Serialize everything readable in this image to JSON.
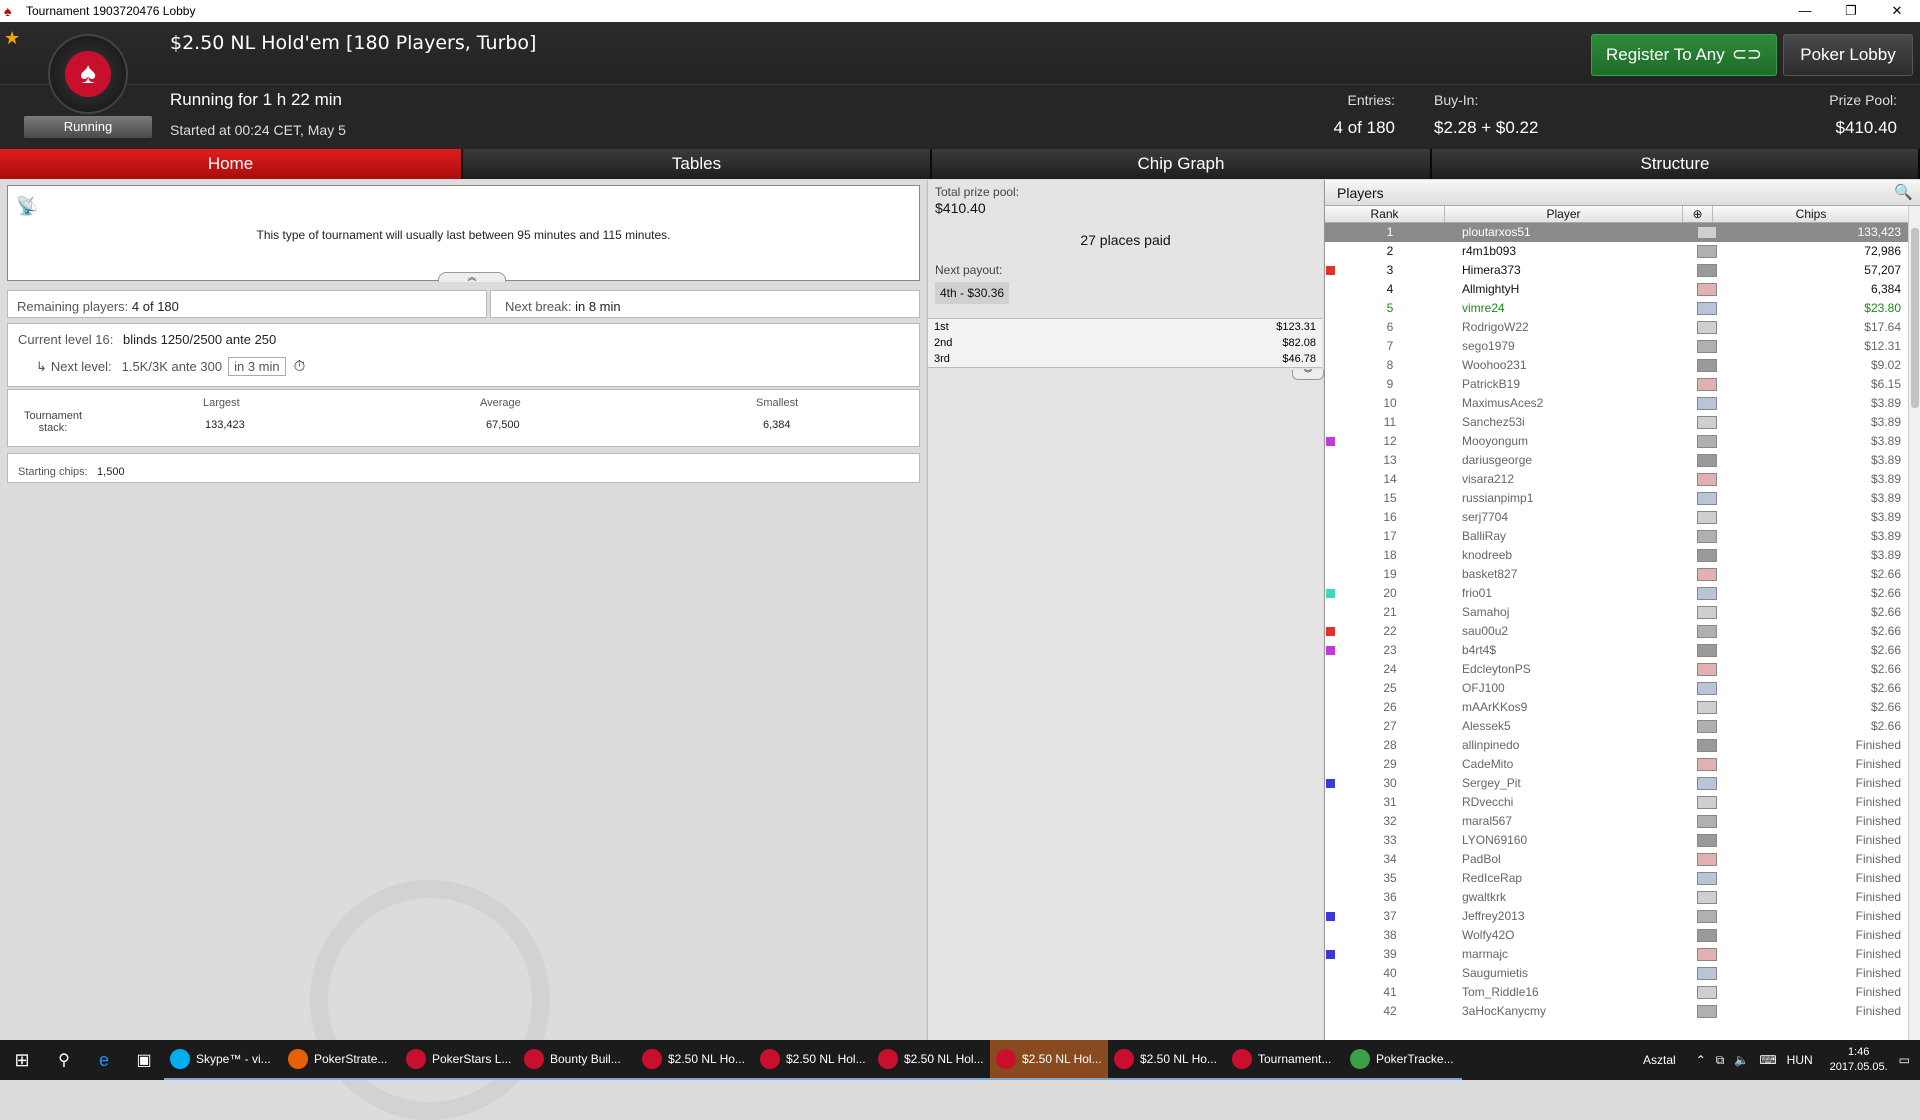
{
  "window": {
    "title": "Tournament 1903720476 Lobby",
    "minimize": "—",
    "restore": "❐",
    "close": "✕"
  },
  "header": {
    "title": "$2.50 NL Hold'em [180 Players, Turbo]",
    "running_for": "Running for 1 h 22 min",
    "started_at": "Started at 00:24 CET, May 5",
    "status_badge": "Running",
    "register_button": "Register To Any",
    "lobby_button": "Poker Lobby",
    "entries_label": "Entries:",
    "entries_value": "4 of 180",
    "buyin_label": "Buy-In:",
    "buyin_value": "$2.28 + $0.22",
    "prizepool_label": "Prize Pool:",
    "prizepool_value": "$410.40"
  },
  "tabs": [
    {
      "label": "Home",
      "active": true
    },
    {
      "label": "Tables",
      "active": false
    },
    {
      "label": "Chip Graph",
      "active": false
    },
    {
      "label": "Structure",
      "active": false
    }
  ],
  "home": {
    "info_text": "This type of tournament will usually last between 95 minutes and 115 minutes.",
    "remaining_label": "Remaining players:",
    "remaining_value": "4 of 180",
    "break_label": "Next break:",
    "break_value": "in 8 min",
    "current_level_label": "Current level 16:",
    "current_level_value": "blinds 1250/2500 ante 250",
    "next_level_label": "Next level:",
    "next_level_value": "1.5K/3K ante 300",
    "next_level_time": "in 3 min",
    "stack_label": "Tournament stack:",
    "largest_label": "Largest",
    "largest_value": "133,423",
    "average_label": "Average",
    "average_value": "67,500",
    "smallest_label": "Smallest",
    "smallest_value": "6,384",
    "starting_chips_label": "Starting chips:",
    "starting_chips_value": "1,500"
  },
  "prizes": {
    "total_label": "Total prize pool:",
    "total_value": "$410.40",
    "places_paid": "27 places paid",
    "next_payout_label": "Next payout:",
    "next_payout_value": "4th - $30.36",
    "payouts": [
      {
        "place": "1st",
        "amount": "$123.31"
      },
      {
        "place": "2nd",
        "amount": "$82.08"
      },
      {
        "place": "3rd",
        "amount": "$46.78"
      }
    ]
  },
  "players": {
    "title": "Players",
    "col_rank": "Rank",
    "col_player": "Player",
    "col_chips": "Chips",
    "rows": [
      {
        "rank": "1",
        "name": "ploutarxos51",
        "chips": "133,423",
        "style": "sel",
        "marker": ""
      },
      {
        "rank": "2",
        "name": "r4m1b093",
        "chips": "72,986",
        "style": "",
        "marker": ""
      },
      {
        "rank": "3",
        "name": "Himera373",
        "chips": "57,207",
        "style": "",
        "marker": "#e0312a"
      },
      {
        "rank": "4",
        "name": "AllmightyH",
        "chips": "6,384",
        "style": "",
        "marker": ""
      },
      {
        "rank": "5",
        "name": "vimre24",
        "chips": "$23.80",
        "style": "green",
        "marker": ""
      },
      {
        "rank": "6",
        "name": "RodrigoW22",
        "chips": "$17.64",
        "style": "grey",
        "marker": ""
      },
      {
        "rank": "7",
        "name": "sego1979",
        "chips": "$12.31",
        "style": "grey",
        "marker": ""
      },
      {
        "rank": "8",
        "name": "Woohoo231",
        "chips": "$9.02",
        "style": "grey",
        "marker": ""
      },
      {
        "rank": "9",
        "name": "PatrickB19",
        "chips": "$6.15",
        "style": "grey",
        "marker": ""
      },
      {
        "rank": "10",
        "name": "MaximusAces2",
        "chips": "$3.89",
        "style": "grey",
        "marker": ""
      },
      {
        "rank": "11",
        "name": "Sanchez53i",
        "chips": "$3.89",
        "style": "grey",
        "marker": ""
      },
      {
        "rank": "12",
        "name": "Mooyongum",
        "chips": "$3.89",
        "style": "grey",
        "marker": "#c23ad8"
      },
      {
        "rank": "13",
        "name": "dariusgeorge",
        "chips": "$3.89",
        "style": "grey",
        "marker": ""
      },
      {
        "rank": "14",
        "name": "visara212",
        "chips": "$3.89",
        "style": "grey",
        "marker": ""
      },
      {
        "rank": "15",
        "name": "russianpimp1",
        "chips": "$3.89",
        "style": "grey",
        "marker": ""
      },
      {
        "rank": "16",
        "name": "serj7704",
        "chips": "$3.89",
        "style": "grey",
        "marker": ""
      },
      {
        "rank": "17",
        "name": "BalliRay",
        "chips": "$3.89",
        "style": "grey",
        "marker": ""
      },
      {
        "rank": "18",
        "name": "knodreeb",
        "chips": "$3.89",
        "style": "grey",
        "marker": ""
      },
      {
        "rank": "19",
        "name": "basket827",
        "chips": "$2.66",
        "style": "grey",
        "marker": ""
      },
      {
        "rank": "20",
        "name": "frio01",
        "chips": "$2.66",
        "style": "grey",
        "marker": "#3fd6c4"
      },
      {
        "rank": "21",
        "name": "Samahoj",
        "chips": "$2.66",
        "style": "grey",
        "marker": ""
      },
      {
        "rank": "22",
        "name": "sau00u2",
        "chips": "$2.66",
        "style": "grey",
        "marker": "#e0312a"
      },
      {
        "rank": "23",
        "name": "b4rt4$",
        "chips": "$2.66",
        "style": "grey",
        "marker": "#c23ad8"
      },
      {
        "rank": "24",
        "name": "EdcleytonPS",
        "chips": "$2.66",
        "style": "grey",
        "marker": ""
      },
      {
        "rank": "25",
        "name": "OFJ100",
        "chips": "$2.66",
        "style": "grey",
        "marker": ""
      },
      {
        "rank": "26",
        "name": "mAArKKos9",
        "chips": "$2.66",
        "style": "grey",
        "marker": ""
      },
      {
        "rank": "27",
        "name": "Alessek5",
        "chips": "$2.66",
        "style": "grey",
        "marker": ""
      },
      {
        "rank": "28",
        "name": "allinpinedo",
        "chips": "Finished",
        "style": "grey",
        "marker": ""
      },
      {
        "rank": "29",
        "name": "CadeMito",
        "chips": "Finished",
        "style": "grey",
        "marker": ""
      },
      {
        "rank": "30",
        "name": "Sergey_Pit",
        "chips": "Finished",
        "style": "grey",
        "marker": "#3a3ad8"
      },
      {
        "rank": "31",
        "name": "RDvecchi",
        "chips": "Finished",
        "style": "grey",
        "marker": ""
      },
      {
        "rank": "32",
        "name": "maral567",
        "chips": "Finished",
        "style": "grey",
        "marker": ""
      },
      {
        "rank": "33",
        "name": "LYON69160",
        "chips": "Finished",
        "style": "grey",
        "marker": ""
      },
      {
        "rank": "34",
        "name": "PadBol",
        "chips": "Finished",
        "style": "grey",
        "marker": ""
      },
      {
        "rank": "35",
        "name": "RedIceRap",
        "chips": "Finished",
        "style": "grey",
        "marker": ""
      },
      {
        "rank": "36",
        "name": "gwaltkrk",
        "chips": "Finished",
        "style": "grey",
        "marker": ""
      },
      {
        "rank": "37",
        "name": "Jeffrey2013",
        "chips": "Finished",
        "style": "grey",
        "marker": "#3a3ad8"
      },
      {
        "rank": "38",
        "name": "Wolfy42O",
        "chips": "Finished",
        "style": "grey",
        "marker": ""
      },
      {
        "rank": "39",
        "name": "marmajc",
        "chips": "Finished",
        "style": "grey",
        "marker": "#3a3ad8"
      },
      {
        "rank": "40",
        "name": "Saugumietis",
        "chips": "Finished",
        "style": "grey",
        "marker": ""
      },
      {
        "rank": "41",
        "name": "Tom_Riddle16",
        "chips": "Finished",
        "style": "grey",
        "marker": ""
      },
      {
        "rank": "42",
        "name": "3aHocKanycmy",
        "chips": "Finished",
        "style": "grey",
        "marker": ""
      }
    ]
  },
  "taskbar": {
    "apps": [
      {
        "label": "Skype™ - vi...",
        "color": "#00aff0",
        "hl": false
      },
      {
        "label": "PokerStrate...",
        "color": "#e66000",
        "hl": false
      },
      {
        "label": "PokerStars L...",
        "color": "#c8102e",
        "hl": false
      },
      {
        "label": "Bounty Buil...",
        "color": "#c8102e",
        "hl": false
      },
      {
        "label": "$2.50 NL Ho...",
        "color": "#c8102e",
        "hl": false
      },
      {
        "label": "$2.50 NL Hol...",
        "color": "#c8102e",
        "hl": false
      },
      {
        "label": "$2.50 NL Hol...",
        "color": "#c8102e",
        "hl": false
      },
      {
        "label": "$2.50 NL Hol...",
        "color": "#c8102e",
        "hl": true
      },
      {
        "label": "$2.50 NL Ho...",
        "color": "#c8102e",
        "hl": false
      },
      {
        "label": "Tournament...",
        "color": "#c8102e",
        "hl": false
      },
      {
        "label": "PokerTracke...",
        "color": "#3aa048",
        "hl": false
      }
    ],
    "desktop_label": "Asztal",
    "lang": "HUN",
    "time": "1:46",
    "date": "2017.05.05."
  }
}
